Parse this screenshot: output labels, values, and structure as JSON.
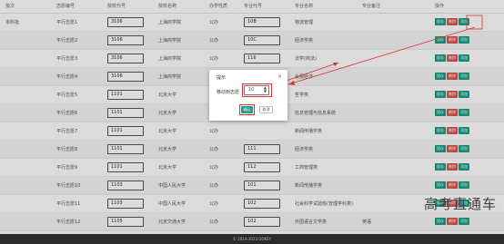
{
  "table": {
    "headers": [
      "批次",
      "志愿编号",
      "院校代号",
      "院校名称",
      "办学性质",
      "专业代号",
      "专业名称",
      "专业备注",
      "操作"
    ],
    "rows": [
      {
        "batch": "本科批",
        "vol": "平行志愿1",
        "school_code": "3106",
        "school": "上海商学院",
        "nature": "公办",
        "major_code": "10B",
        "major": "物流管理"
      },
      {
        "batch": "",
        "vol": "平行志愿2",
        "school_code": "3106",
        "school": "上海商学院",
        "nature": "公办",
        "major_code": "10C",
        "major": "经济学类"
      },
      {
        "batch": "",
        "vol": "平行志愿3",
        "school_code": "3106",
        "school": "上海商学院",
        "nature": "公办",
        "major_code": "116",
        "major": "法学(商法)"
      },
      {
        "batch": "",
        "vol": "平行志愿4",
        "school_code": "3106",
        "school": "上海商学院",
        "nature": "公办",
        "major_code": "",
        "major": "会展经济"
      },
      {
        "batch": "",
        "vol": "平行志愿5",
        "school_code": "1101",
        "school": "北京大学",
        "nature": "公办",
        "major_code": "",
        "major": "哲学类"
      },
      {
        "batch": "",
        "vol": "平行志愿6",
        "school_code": "1101",
        "school": "北京大学",
        "nature": "公办",
        "major_code": "",
        "major": "信息管理与信息系统"
      },
      {
        "batch": "",
        "vol": "平行志愿7",
        "school_code": "1101",
        "school": "北京大学",
        "nature": "公办",
        "major_code": "",
        "major": "新闻传播学类"
      },
      {
        "batch": "",
        "vol": "平行志愿8",
        "school_code": "1101",
        "school": "北京大学",
        "nature": "公办",
        "major_code": "111",
        "major": "经济学类"
      },
      {
        "batch": "",
        "vol": "平行志愿9",
        "school_code": "1101",
        "school": "北京大学",
        "nature": "公办",
        "major_code": "112",
        "major": "工商管理类"
      },
      {
        "batch": "",
        "vol": "平行志愿10",
        "school_code": "1103",
        "school": "中国人民大学",
        "nature": "公办",
        "major_code": "101",
        "major": "新闻传播学类"
      },
      {
        "batch": "",
        "vol": "平行志愿11",
        "school_code": "1103",
        "school": "中国人民大学",
        "nature": "公办",
        "major_code": "102",
        "major": "社会科学试验班(管理学科类)"
      },
      {
        "batch": "",
        "vol": "平行志愿12",
        "school_code": "1105",
        "school": "北京交通大学",
        "nature": "公办",
        "major_code": "102",
        "major": "外国语言文学类"
      }
    ],
    "remark_partial": "英语"
  },
  "actions": {
    "save": "保存",
    "delete": "删除",
    "add": "添加"
  },
  "modal": {
    "title": "提示",
    "close": "×",
    "label": "移动到志愿",
    "value": "10",
    "confirm": "确认",
    "cancel": "取消"
  },
  "watermark": "高考直通车",
  "footer": "© 2014-2023 GOKEY",
  "colors": {
    "save": "#1e9e83",
    "delete": "#d9534f",
    "add": "#1aa08a",
    "annotation": "#e03030"
  }
}
